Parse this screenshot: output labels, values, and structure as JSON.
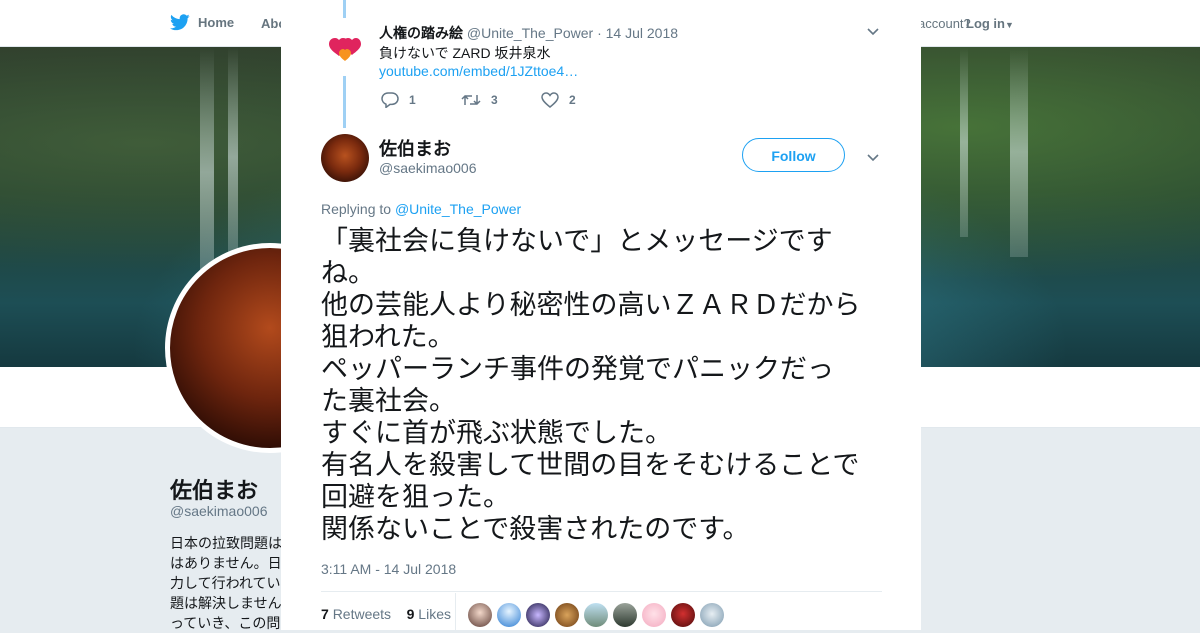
{
  "background_page": {
    "nav": {
      "home_label": "Home",
      "about_label": "Abo",
      "account_text": "account?",
      "login_label": "Log in"
    },
    "profile": {
      "name": "佐伯まお",
      "handle": "@saekimao006",
      "bio_lines": [
        "日本の拉致問題は",
        "はありません。日",
        "力して行われてい",
        "題は解決しません",
        "っていき、この問"
      ]
    }
  },
  "modal": {
    "parent_tweet": {
      "name": "人権の踏み絵",
      "handle": "@Unite_The_Power",
      "separator": "·",
      "date": "14 Jul 2018",
      "text": "負けないで ZARD 坂井泉水",
      "link": "youtube.com/embed/1JZttoe4…",
      "reply_count": "1",
      "retweet_count": "3",
      "like_count": "2"
    },
    "main_tweet": {
      "name": "佐伯まお",
      "handle": "@saekimao006",
      "follow_label": "Follow",
      "replying_prefix": "Replying to",
      "replying_handle": "@Unite_The_Power",
      "text_lines": [
        "「裏社会に負けないで」とメッセージです",
        "ね。",
        "他の芸能人より秘密性の高いＺＡＲＤだから",
        "狙われた。",
        "ペッパーランチ事件の発覚でパニックだっ",
        "た裏社会。",
        "すぐに首が飛ぶ状態でした。",
        "有名人を殺害して世間の目をそむけることで",
        "回避を狙った。",
        "関係ないことで殺害されたのです。"
      ],
      "timestamp": "3:11 AM - 14 Jul 2018",
      "retweets_count": "7",
      "retweets_label": "Retweets",
      "likes_count": "9",
      "likes_label": "Likes"
    }
  },
  "colors": {
    "accent": "#1da1f2",
    "thread_line": "#9fd0f4",
    "secondary_text": "#657786",
    "heart_red": "#e0245e",
    "heart_orange": "#f7931e"
  },
  "icons": [
    "twitter-bird-icon",
    "chevron-down-icon",
    "reply-icon",
    "retweet-icon",
    "like-icon",
    "close-icon",
    "heart-logo-icon"
  ]
}
